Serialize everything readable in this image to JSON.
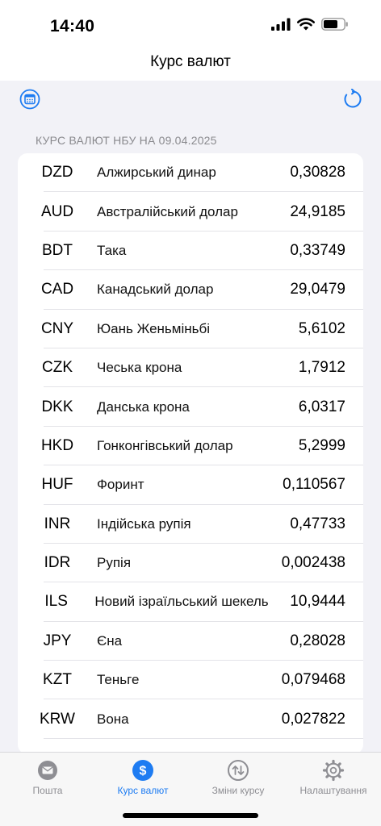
{
  "status_bar": {
    "time": "14:40"
  },
  "nav": {
    "title": "Курс валют"
  },
  "section": {
    "header": "КУРС ВАЛЮТ НБУ НА 09.04.2025"
  },
  "rates": [
    {
      "code": "DZD",
      "name": "Алжирський динар",
      "rate": "0,30828"
    },
    {
      "code": "AUD",
      "name": "Австралійський долар",
      "rate": "24,9185"
    },
    {
      "code": "BDT",
      "name": "Така",
      "rate": "0,33749"
    },
    {
      "code": "CAD",
      "name": "Канадський долар",
      "rate": "29,0479"
    },
    {
      "code": "CNY",
      "name": "Юань Женьміньбі",
      "rate": "5,6102"
    },
    {
      "code": "CZK",
      "name": "Чеська крона",
      "rate": "1,7912"
    },
    {
      "code": "DKK",
      "name": "Данська крона",
      "rate": "6,0317"
    },
    {
      "code": "HKD",
      "name": "Гонконгівський долар",
      "rate": "5,2999"
    },
    {
      "code": "HUF",
      "name": "Форинт",
      "rate": "0,110567"
    },
    {
      "code": "INR",
      "name": "Індійська рупія",
      "rate": "0,47733"
    },
    {
      "code": "IDR",
      "name": "Рупія",
      "rate": "0,002438"
    },
    {
      "code": "ILS",
      "name": "Новий ізраїльський шекель",
      "rate": "10,9444"
    },
    {
      "code": "JPY",
      "name": "Єна",
      "rate": "0,28028"
    },
    {
      "code": "KZT",
      "name": "Теньге",
      "rate": "0,079468"
    },
    {
      "code": "KRW",
      "name": "Вона",
      "rate": "0,027822"
    }
  ],
  "tabs": [
    {
      "label": "Пошта",
      "icon": "envelope-icon",
      "active": false
    },
    {
      "label": "Курс валют",
      "icon": "dollar-circle-icon",
      "active": true
    },
    {
      "label": "Зміни курсу",
      "icon": "arrows-updown-icon",
      "active": false
    },
    {
      "label": "Налаштування",
      "icon": "gear-icon",
      "active": false
    }
  ],
  "colors": {
    "accent": "#1E7CF2",
    "inactive": "#8E8E93",
    "background": "#F2F2F7"
  }
}
